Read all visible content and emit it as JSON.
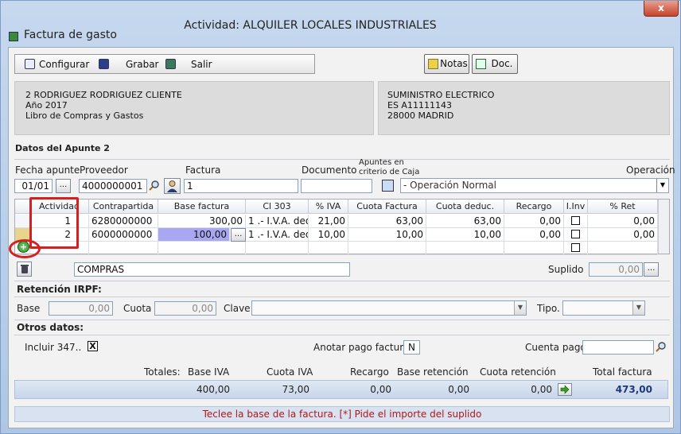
{
  "window": {
    "title": "Actividad: ALQUILER LOCALES INDUSTRIALES",
    "subtitle": "Factura de gasto",
    "close": "x"
  },
  "toolbar": {
    "configurar": "Configurar",
    "grabar": "Grabar",
    "salir": "Salir",
    "notas": "Notas",
    "doc": "Doc."
  },
  "client": {
    "line1": "2 RODRIGUEZ RODRIGUEZ CLIENTE",
    "line2": "Año 2017",
    "line3": "Libro de Compras y Gastos"
  },
  "supplier": {
    "line1": "SUMINISTRO ELECTRICO",
    "line2": "ES A11111143",
    "line3": "28000 MADRID"
  },
  "apunte": {
    "heading": "Datos del Apunte 2",
    "fecha_label": "Fecha apunte",
    "fecha": "01/01",
    "proveedor_label": "Proveedor",
    "proveedor": "4000000001",
    "factura_label": "Factura",
    "factura": "1",
    "documento_label": "Documento",
    "documento": "",
    "caja_label": "Apuntes en criterio de Caja",
    "operacion_label": "Operación",
    "operacion": "- Operación Normal",
    "ellipsis": "..."
  },
  "grid": {
    "headers": [
      "Actividad",
      "Contrapartida",
      "Base factura",
      "Cl 303",
      "% IVA",
      "Cuota Factura",
      "Cuota deduc.",
      "Recargo",
      "I.Inv",
      "% Ret"
    ],
    "rows": [
      {
        "actividad": "1",
        "contrapartida": "6280000000",
        "base": "300,00",
        "cl303": "1 .- I.V.A. ded",
        "iva": "21,00",
        "cuota": "63,00",
        "deduc": "63,00",
        "recargo": "0,00",
        "ret": "0,00"
      },
      {
        "actividad": "2",
        "contrapartida": "6000000000",
        "base": "100,00",
        "cl303": "1 .- I.V.A. ded",
        "iva": "10,00",
        "cuota": "10,00",
        "deduc": "10,00",
        "recargo": "0,00",
        "ret": "0,00"
      }
    ]
  },
  "concepto": "COMPRAS",
  "suplido": {
    "label": "Suplido",
    "value": "0,00"
  },
  "retencion": {
    "heading": "Retención IRPF:",
    "base_label": "Base",
    "base": "0,00",
    "cuota_label": "Cuota",
    "cuota": "0,00",
    "clave_label": "Clave",
    "clave": "",
    "tipo_label": "Tipo.",
    "tipo": ""
  },
  "otros": {
    "heading": "Otros datos:",
    "incluir_label": "Incluir 347..",
    "incluir": "X",
    "anotar_label": "Anotar pago factura",
    "anotar": "N",
    "cuenta_label": "Cuenta pago",
    "cuenta": ""
  },
  "totals": {
    "label": "Totales:",
    "base_iva_label": "Base IVA",
    "cuota_iva_label": "Cuota IVA",
    "recargo_label": "Recargo",
    "base_ret_label": "Base retención",
    "cuota_ret_label": "Cuota retención",
    "total_label": "Total factura",
    "base_iva": "400,00",
    "cuota_iva": "73,00",
    "recargo": "0,00",
    "base_ret": "0,00",
    "cuota_ret": "0,00",
    "total": "473,00"
  },
  "status": "Teclee la base de la factura.  [*] Pide el importe del suplido"
}
